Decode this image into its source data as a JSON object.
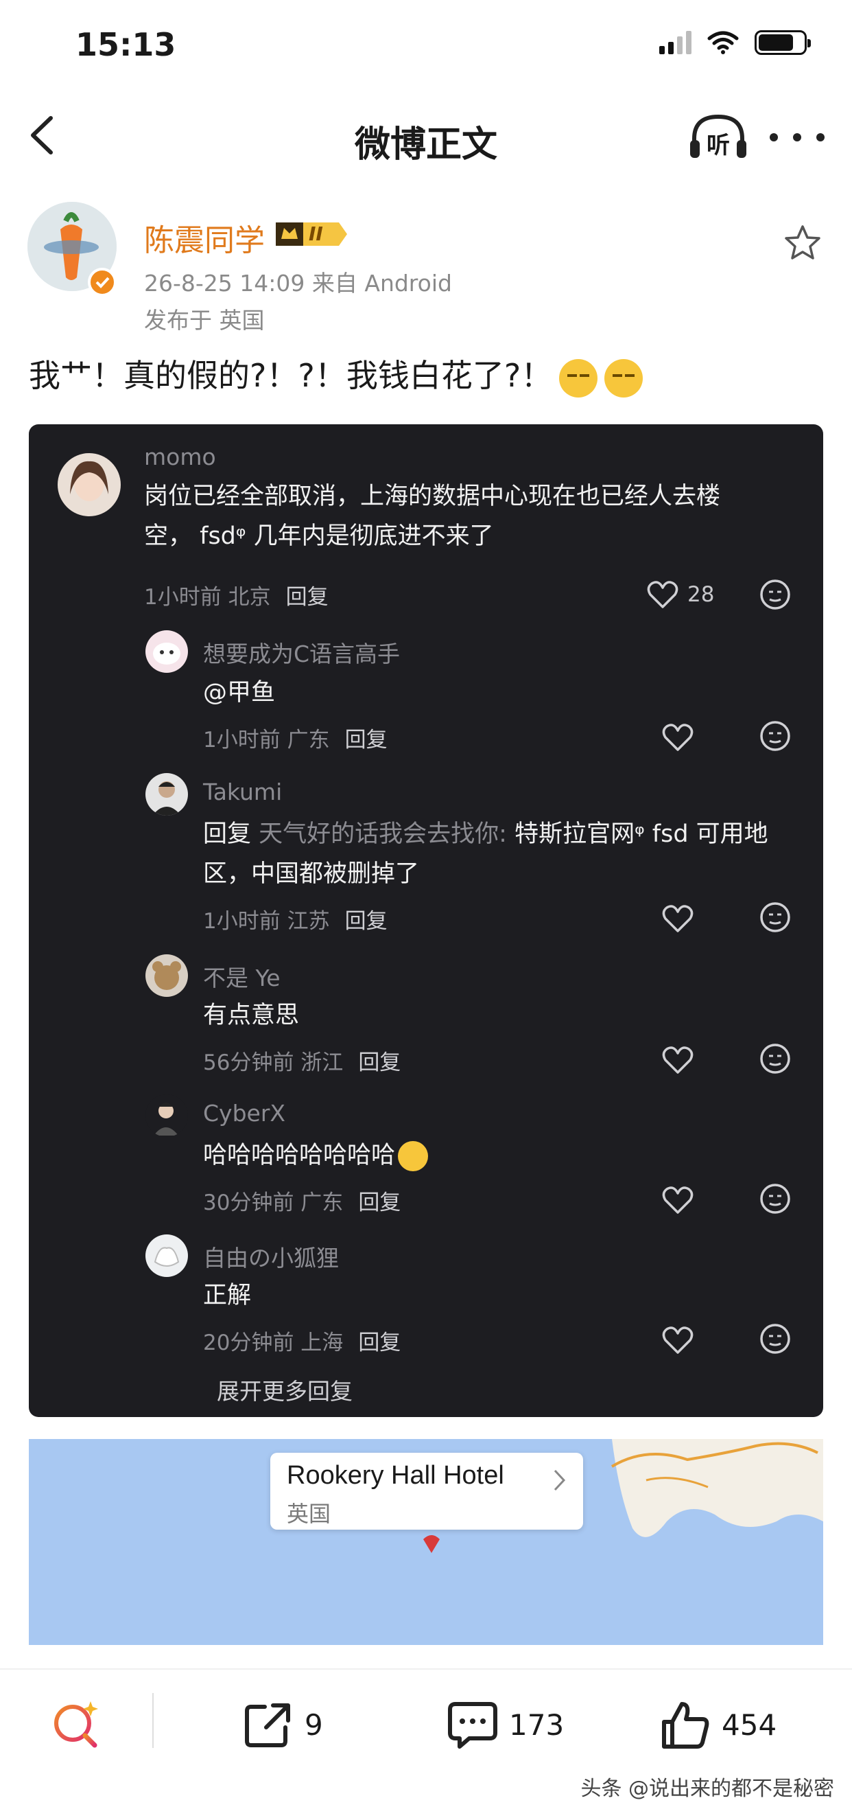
{
  "status_bar": {
    "time": "15:13"
  },
  "nav": {
    "title": "微博正文",
    "listen_label": "听"
  },
  "post": {
    "author_name": "陈震同学",
    "vip_level": "II",
    "meta": "26-8-25 14:09  来自 Android",
    "location": "发布于 英国",
    "text": "我艹！真的假的?！?！我钱白花了?！"
  },
  "comments": {
    "top": {
      "user": "momo",
      "text_line1": "岗位已经全部取消，上海的数据中心现在也已经人去楼",
      "text_line2": "空， fsdᵠ 几年内是彻底进不来了",
      "meta": "1小时前 北京",
      "reply_label": "回复",
      "likes": "28"
    },
    "replies": [
      {
        "user": "想要成为C语言高手",
        "text": "@甲鱼",
        "meta": "1小时前 广东",
        "reply_label": "回复"
      },
      {
        "user": "Takumi",
        "reply_prefix": "回复",
        "reply_to": "天气好的话我会去找你:",
        "text_line1": "特斯拉官网ᵠ  fsd 可用地",
        "text_line2": "区，中国都被删掉了",
        "meta": "1小时前 江苏",
        "reply_label": "回复"
      },
      {
        "user": "不是 Ye",
        "text": "有点意思",
        "meta": "56分钟前 浙江",
        "reply_label": "回复"
      },
      {
        "user": "CyberX",
        "text": "哈哈哈哈哈哈哈哈",
        "meta": "30分钟前 广东",
        "reply_label": "回复"
      },
      {
        "user": "自由の小狐狸",
        "text": "正解",
        "meta": "20分钟前 上海",
        "reply_label": "回复"
      }
    ],
    "more_replies": "展开更多回复"
  },
  "map": {
    "place": "Rookery Hall Hotel",
    "country": "英国"
  },
  "bottom_bar": {
    "share_count": "9",
    "comment_count": "173",
    "like_count": "454"
  },
  "watermark": "头条 @说出来的都不是秘密",
  "colors": {
    "author_orange": "#e07a1c",
    "card_bg": "#1d1d21",
    "map_water": "#a8c8f2"
  }
}
